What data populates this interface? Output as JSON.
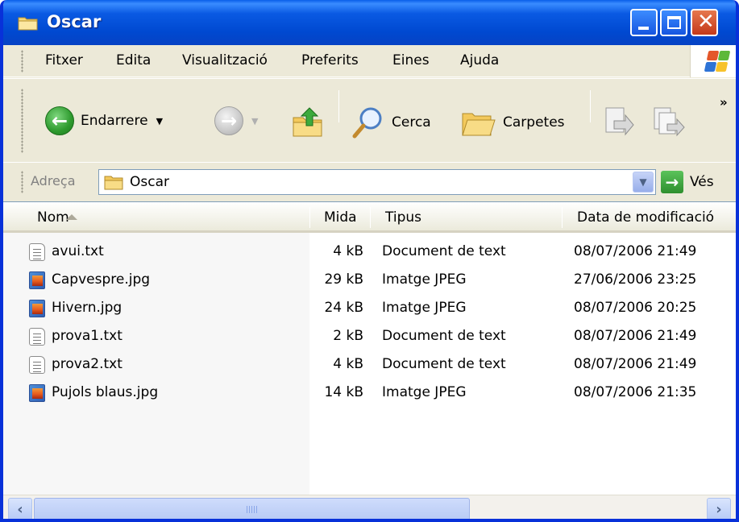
{
  "window": {
    "title": "Oscar"
  },
  "menu": [
    "Fitxer",
    "Edita",
    "Visualització",
    "Preferits",
    "Eines",
    "Ajuda"
  ],
  "toolbar": {
    "back_label": "Endarrere",
    "search_label": "Cerca",
    "folders_label": "Carpetes",
    "more": "»"
  },
  "address": {
    "label": "Adreça",
    "value": "Oscar",
    "go_label": "Vés"
  },
  "columns": {
    "name": "Nom",
    "size": "Mida",
    "type": "Tipus",
    "date": "Data de modificació"
  },
  "files": [
    {
      "name": "avui.txt",
      "size": "4 kB",
      "type": "Document de text",
      "date": "08/07/2006 21:49",
      "icon": "text-file-icon"
    },
    {
      "name": "Capvespre.jpg",
      "size": "29 kB",
      "type": "Imatge JPEG",
      "date": "27/06/2006 23:25",
      "icon": "jpeg-image-icon"
    },
    {
      "name": "Hivern.jpg",
      "size": "24 kB",
      "type": "Imatge JPEG",
      "date": "08/07/2006 20:25",
      "icon": "jpeg-image-icon"
    },
    {
      "name": "prova1.txt",
      "size": "2 kB",
      "type": "Document de text",
      "date": "08/07/2006 21:49",
      "icon": "text-file-icon"
    },
    {
      "name": "prova2.txt",
      "size": "4 kB",
      "type": "Document de text",
      "date": "08/07/2006 21:49",
      "icon": "text-file-icon"
    },
    {
      "name": "Pujols blaus.jpg",
      "size": "14 kB",
      "type": "Imatge JPEG",
      "date": "08/07/2006 21:35",
      "icon": "jpeg-image-icon"
    }
  ],
  "colors": {
    "titlebar": "#0054E3",
    "chrome": "#ECE9D8",
    "sorted_column": "#F7F7F7"
  }
}
